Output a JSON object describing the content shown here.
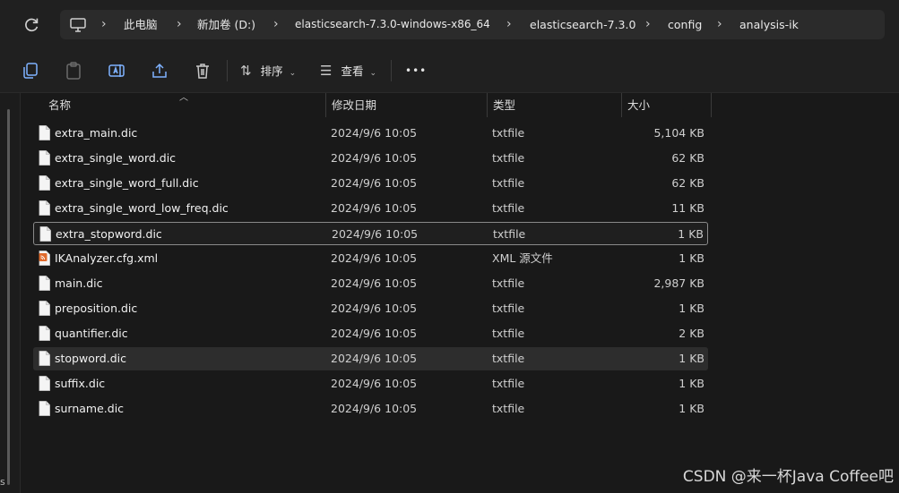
{
  "breadcrumb": [
    "此电脑",
    "新加卷 (D:)",
    "elasticsearch-7.3.0-windows-x86_64",
    "elasticsearch-7.3.0",
    "config",
    "analysis-ik"
  ],
  "toolbar": {
    "sort_label": "排序",
    "view_label": "查看",
    "more_label": "•••"
  },
  "columns": {
    "name": "名称",
    "date": "修改日期",
    "type": "类型",
    "size": "大小"
  },
  "files": [
    {
      "name": "extra_main.dic",
      "date": "2024/9/6 10:05",
      "type": "txtfile",
      "size": "5,104 KB",
      "icon": "document-icon"
    },
    {
      "name": "extra_single_word.dic",
      "date": "2024/9/6 10:05",
      "type": "txtfile",
      "size": "62 KB",
      "icon": "document-icon"
    },
    {
      "name": "extra_single_word_full.dic",
      "date": "2024/9/6 10:05",
      "type": "txtfile",
      "size": "62 KB",
      "icon": "document-icon"
    },
    {
      "name": "extra_single_word_low_freq.dic",
      "date": "2024/9/6 10:05",
      "type": "txtfile",
      "size": "11 KB",
      "icon": "document-icon"
    },
    {
      "name": "extra_stopword.dic",
      "date": "2024/9/6 10:05",
      "type": "txtfile",
      "size": "1 KB",
      "icon": "document-icon",
      "state": "selected"
    },
    {
      "name": "IKAnalyzer.cfg.xml",
      "date": "2024/9/6 10:05",
      "type": "XML 源文件",
      "size": "1 KB",
      "icon": "xml-file-icon"
    },
    {
      "name": "main.dic",
      "date": "2024/9/6 10:05",
      "type": "txtfile",
      "size": "2,987 KB",
      "icon": "document-icon"
    },
    {
      "name": "preposition.dic",
      "date": "2024/9/6 10:05",
      "type": "txtfile",
      "size": "1 KB",
      "icon": "document-icon"
    },
    {
      "name": "quantifier.dic",
      "date": "2024/9/6 10:05",
      "type": "txtfile",
      "size": "2 KB",
      "icon": "document-icon"
    },
    {
      "name": "stopword.dic",
      "date": "2024/9/6 10:05",
      "type": "txtfile",
      "size": "1 KB",
      "icon": "document-icon",
      "state": "hover"
    },
    {
      "name": "suffix.dic",
      "date": "2024/9/6 10:05",
      "type": "txtfile",
      "size": "1 KB",
      "icon": "document-icon"
    },
    {
      "name": "surname.dic",
      "date": "2024/9/6 10:05",
      "type": "txtfile",
      "size": "1 KB",
      "icon": "document-icon"
    }
  ],
  "watermark": "CSDN @来一杯Java Coffee吧",
  "left_pane_glyph": "s",
  "colors": {
    "background": "#191919",
    "selected_border": "#8a8a8a",
    "xml_icon": "#e06a2c"
  }
}
